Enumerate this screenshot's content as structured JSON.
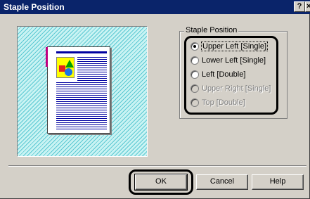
{
  "window": {
    "title": "Staple Position",
    "help_label": "?",
    "close_label": "×"
  },
  "group": {
    "legend": "Staple Position",
    "options": [
      {
        "label": "Upper Left [Single]",
        "checked": true,
        "enabled": true
      },
      {
        "label": "Lower Left [Single]",
        "checked": false,
        "enabled": true
      },
      {
        "label": "Left [Double]",
        "checked": false,
        "enabled": true
      },
      {
        "label": "Upper Right [Single]",
        "checked": false,
        "enabled": false
      },
      {
        "label": "Top [Double]",
        "checked": false,
        "enabled": false
      }
    ]
  },
  "buttons": {
    "ok": "OK",
    "cancel": "Cancel",
    "help": "Help"
  },
  "colors": {
    "titlebar": "#0a246a",
    "preview_hatch": "#5bc8d2",
    "staple_mark": "#e0006a"
  }
}
